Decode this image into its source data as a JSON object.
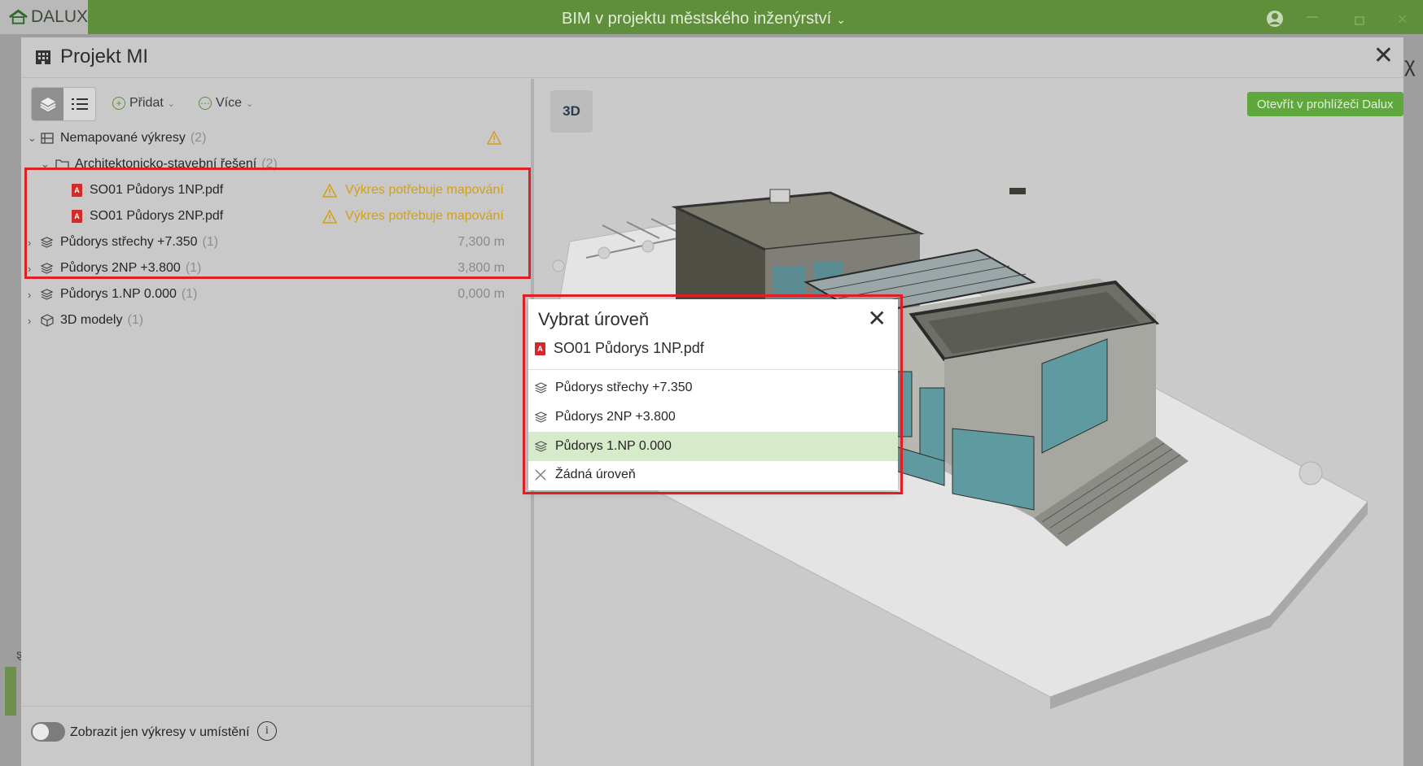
{
  "app": {
    "logo_text": "DALUX",
    "title": "BIM v projektu městského inženýrství",
    "title_chevron": "⌄",
    "side_letter": "ȿ",
    "side_x": "χ",
    "accent_color": "#5f8f3a"
  },
  "modal": {
    "title": "Projekt MI",
    "close": "✕"
  },
  "toolbar": {
    "add_label": "Přidat",
    "more_label": "Více",
    "dropdown": "⌄"
  },
  "tree": [
    {
      "level": 0,
      "arrow": "⌄",
      "icon": "sheets-icon",
      "label": "Nemapované výkresy",
      "count": "(2)",
      "warn": true
    },
    {
      "level": 1,
      "arrow": "⌄",
      "icon": "folder-icon",
      "label": "Architektonicko-stavební řešení",
      "count": "(2)"
    },
    {
      "level": 2,
      "icon": "pdf-icon",
      "label": "SO01 Půdorys 1NP.pdf",
      "status": "Výkres potřebuje mapování"
    },
    {
      "level": 2,
      "icon": "pdf-icon",
      "label": "SO01 Půdorys 2NP.pdf",
      "status": "Výkres potřebuje mapování"
    },
    {
      "level": 0,
      "arrow": "›",
      "icon": "layers-icon",
      "label": "Půdorys střechy +7.350",
      "count": "(1)",
      "elev": "7,300 m"
    },
    {
      "level": 0,
      "arrow": "›",
      "icon": "layers-icon",
      "label": "Půdorys 2NP +3.800",
      "count": "(1)",
      "elev": "3,800 m"
    },
    {
      "level": 0,
      "arrow": "›",
      "icon": "layers-icon",
      "label": "Půdorys 1.NP 0.000",
      "count": "(1)",
      "elev": "0,000 m"
    },
    {
      "level": 0,
      "arrow": "›",
      "icon": "cube-icon",
      "label": "3D modely",
      "count": "(1)"
    }
  ],
  "footer": {
    "toggle_label": "Zobrazit jen výkresy v umístění",
    "toggle_on": false,
    "info": "i"
  },
  "viewer": {
    "mode_button": "3D",
    "open_button": "Otevřít v prohlížeči Dalux"
  },
  "popup": {
    "title": "Vybrat úroveň",
    "close": "✕",
    "file": "SO01 Půdorys 1NP.pdf",
    "options": [
      {
        "label": "Půdorys střechy +7.350",
        "icon": "layers-icon",
        "selected": false
      },
      {
        "label": "Půdorys 2NP +3.800",
        "icon": "layers-icon",
        "selected": false
      },
      {
        "label": "Půdorys 1.NP 0.000",
        "icon": "layers-icon",
        "selected": true
      },
      {
        "label": "Žádná úroveň",
        "icon": "x-icon",
        "selected": false
      }
    ]
  }
}
